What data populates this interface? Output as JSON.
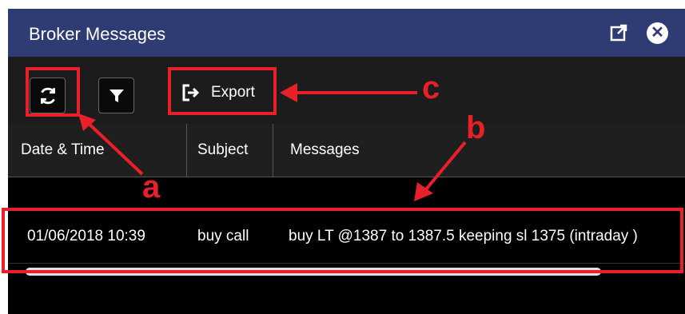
{
  "window": {
    "title": "Broker Messages"
  },
  "toolbar": {
    "refresh_icon": "refresh-icon",
    "filter_icon": "filter-icon",
    "export_label": "Export",
    "export_icon": "export-icon"
  },
  "table": {
    "columns": [
      "Date & Time",
      "Subject",
      "Messages"
    ],
    "rows": [
      {
        "datetime": "01/06/2018 10:39",
        "subject": "buy call",
        "message": "buy LT @1387 to 1387.5 keeping sl 1375 (intraday )"
      }
    ]
  },
  "annotations": {
    "a": "a",
    "b": "b",
    "c": "c",
    "color": "#e8202a"
  },
  "colors": {
    "titlebar": "#2f3b73",
    "background": "#000000"
  }
}
